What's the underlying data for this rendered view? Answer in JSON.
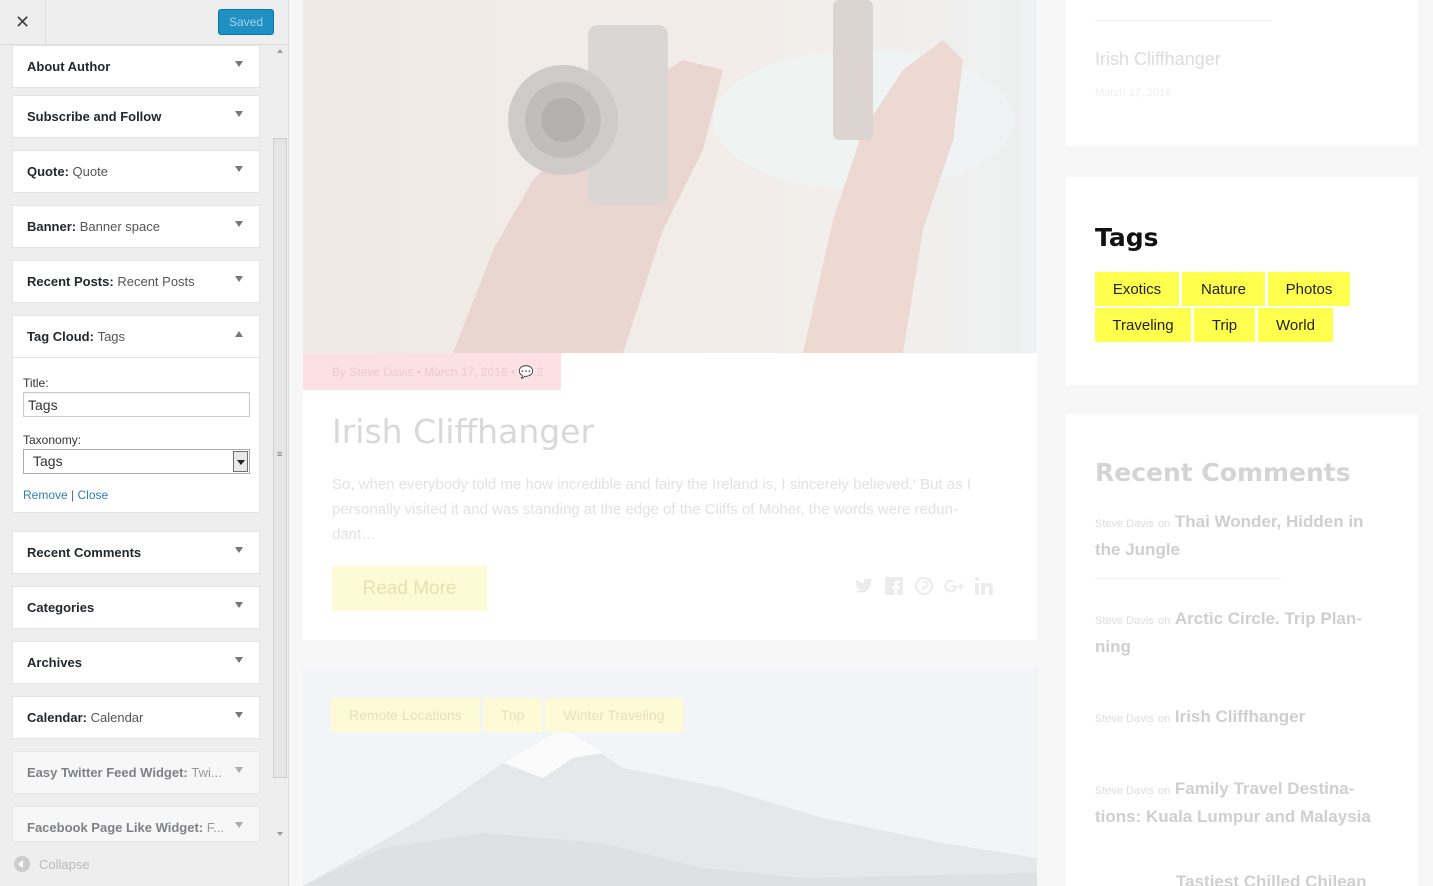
{
  "header": {
    "close_label": "✕",
    "save_label": "Saved"
  },
  "widgets": [
    {
      "name": "About Author",
      "sub": ""
    },
    {
      "name": "Subscribe and Follow",
      "sub": ""
    },
    {
      "name": "Quote",
      "sub": "Quote"
    },
    {
      "name": "Banner",
      "sub": "Banner space"
    },
    {
      "name": "Recent Posts",
      "sub": "Recent Posts"
    },
    {
      "name": "Tag Cloud",
      "sub": "Tags"
    },
    {
      "name": "Recent Comments",
      "sub": ""
    },
    {
      "name": "Categories",
      "sub": ""
    },
    {
      "name": "Archives",
      "sub": ""
    },
    {
      "name": "Calendar",
      "sub": "Calendar"
    },
    {
      "name": "Easy Twitter Feed Widget",
      "sub": "Twi..."
    },
    {
      "name": "Facebook Page Like Widget",
      "sub": "F..."
    }
  ],
  "tag_cloud_form": {
    "title_label": "Title:",
    "title_value": "Tags",
    "taxonomy_label": "Taxonomy:",
    "taxonomy_value": "Tags",
    "remove_label": "Remove",
    "separator": "|",
    "close_label": "Close"
  },
  "collapse_label": "Collapse",
  "post": {
    "meta": "By Steve Davis • March 17, 2016 • 💬 2",
    "title": "Irish Cliffhanger",
    "excerpt": "So, when everybody told me how incredible and fairy the Ireland is, I sincerely believed.' But as I personally visited it and was standing at the edge of the Cliffs of Moher, the words were redun-dant…",
    "read_more": "Read More",
    "share_icons": [
      "twitter-icon",
      "facebook-icon",
      "pinterest-icon",
      "google-plus-icon",
      "linkedin-icon"
    ]
  },
  "post2": {
    "tags": [
      "Remote Locations",
      "Trip",
      "Winter Traveling"
    ]
  },
  "sidebar": {
    "recent": {
      "title": "Irish Cliffhanger",
      "date": "March 17, 2016"
    },
    "tags_title": "Tags",
    "tags": [
      "Exotics",
      "Nature",
      "Photos",
      "Traveling",
      "Trip",
      "World"
    ],
    "comments_title": "Recent Comments",
    "comments": [
      {
        "author": "Steve Davis",
        "on": "on",
        "post": "Thai Wonder, Hidden in the Jungle"
      },
      {
        "author": "Steve Davis",
        "on": "on",
        "post": "Arctic Circle. Trip Plan-ning"
      },
      {
        "author": "Steve Davis",
        "on": "on",
        "post": "Irish Cliffhanger"
      },
      {
        "author": "Steve Davis",
        "on": "on",
        "post": "Family Travel Destina-tions: Kuala Lumpur and Malaysia"
      },
      {
        "author": "",
        "on": "",
        "post": "Tastiest Chilled Chilean"
      }
    ]
  },
  "colors": {
    "accent": "#1f90c3",
    "tag_yellow": "#ffff4d",
    "meta_pink": "#fbe1e4"
  }
}
